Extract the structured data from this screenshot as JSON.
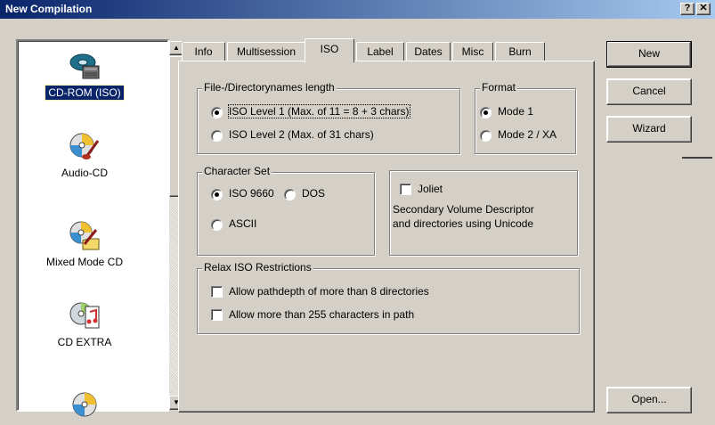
{
  "window": {
    "title": "New Compilation",
    "help_glyph": "?",
    "close_glyph": "✕"
  },
  "compilation_types": [
    {
      "label": "CD-ROM (ISO)",
      "icon": "cd-rom-icon",
      "selected": true
    },
    {
      "label": "Audio-CD",
      "icon": "audio-cd-icon",
      "selected": false
    },
    {
      "label": "Mixed Mode CD",
      "icon": "mixed-mode-cd-icon",
      "selected": false
    },
    {
      "label": "CD EXTRA",
      "icon": "cd-extra-icon",
      "selected": false
    },
    {
      "label": "",
      "icon": "cd-icon",
      "selected": false
    }
  ],
  "tabs": [
    {
      "label": "Info"
    },
    {
      "label": "Multisession"
    },
    {
      "label": "ISO",
      "active": true
    },
    {
      "label": "Label"
    },
    {
      "label": "Dates"
    },
    {
      "label": "Misc"
    },
    {
      "label": "Burn"
    }
  ],
  "iso": {
    "filename_length": {
      "title": "File-/Directorynames length",
      "options": [
        {
          "label": "ISO Level 1 (Max. of 11 = 8 + 3 chars)",
          "checked": true
        },
        {
          "label": "ISO Level 2 (Max. of 31 chars)",
          "checked": false
        }
      ]
    },
    "format": {
      "title": "Format",
      "options": [
        {
          "label": "Mode 1",
          "checked": true
        },
        {
          "label": "Mode 2 / XA",
          "checked": false
        }
      ]
    },
    "character_set": {
      "title": "Character Set",
      "options": [
        {
          "label": "ISO 9660",
          "checked": true
        },
        {
          "label": "DOS",
          "checked": false
        },
        {
          "label": "ASCII",
          "checked": false
        }
      ]
    },
    "joliet": {
      "label": "Joliet",
      "checked": false,
      "description_line1": "Secondary Volume Descriptor",
      "description_line2": "and directories using Unicode"
    },
    "relax": {
      "title": "Relax ISO Restrictions",
      "options": [
        {
          "label": "Allow pathdepth of more than 8 directories",
          "checked": false
        },
        {
          "label": "Allow more than 255 characters in path",
          "checked": false
        }
      ]
    }
  },
  "buttons": {
    "new": "New",
    "cancel": "Cancel",
    "wizard": "Wizard",
    "open": "Open..."
  },
  "colors": {
    "titlebar_start": "#0a246a",
    "titlebar_end": "#a6caf0",
    "face": "#d4d0c8",
    "selection": "#0a246a"
  }
}
